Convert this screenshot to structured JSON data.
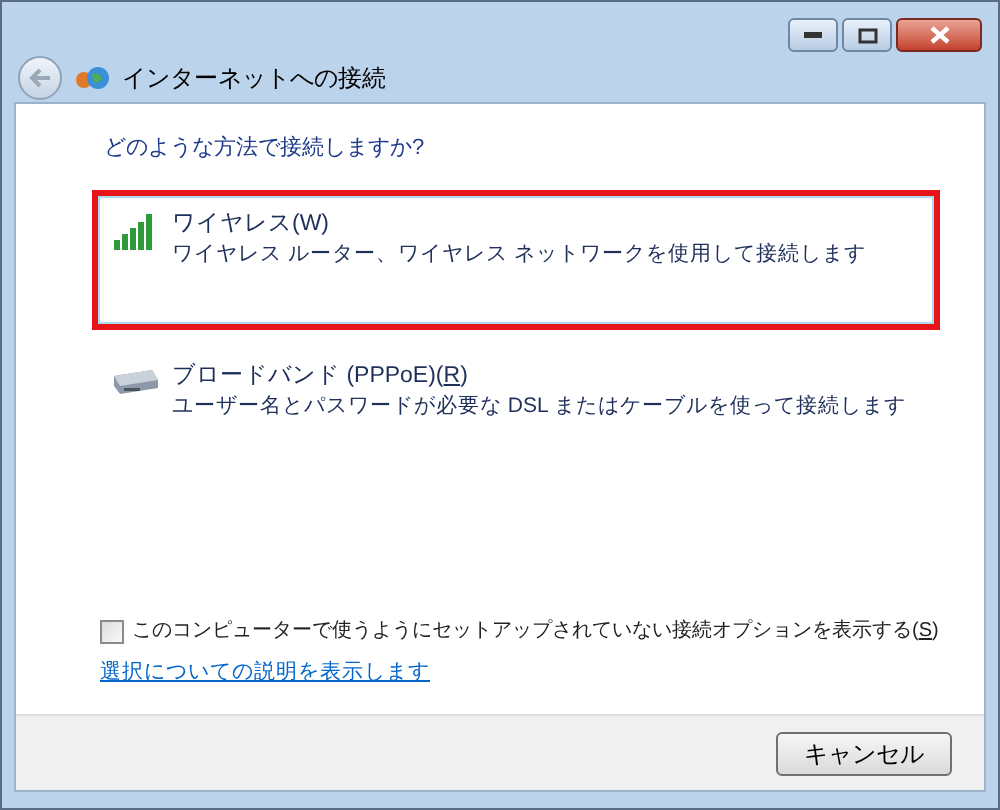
{
  "window": {
    "title": "インターネットへの接続"
  },
  "question": "どのような方法で接続しますか?",
  "options": [
    {
      "kind": "wireless",
      "label": "ワイヤレス(W)",
      "description": "ワイヤレス ルーター、ワイヤレス ネットワークを使用して接続します",
      "selected": true,
      "highlighted": true
    },
    {
      "kind": "broadband",
      "label": "ブロードバンド (PPPoE)(",
      "access_key": "R",
      "label_end": ")",
      "description": "ユーザー名とパスワードが必要な DSL またはケーブルを使って接続します",
      "selected": false,
      "highlighted": false
    }
  ],
  "show_options": {
    "label": "このコンピューターで使うようにセットアップされていない接続オプションを表示する(",
    "access_key": "S",
    "label_end": ")",
    "checked": false
  },
  "help_link": "選択についての説明を表示します",
  "buttons": [
    "キャンセル"
  ]
}
